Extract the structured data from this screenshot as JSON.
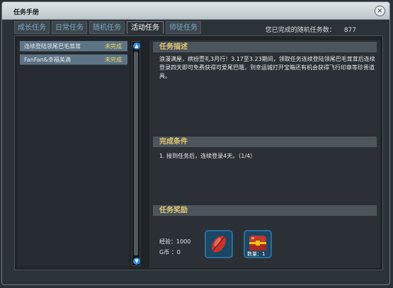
{
  "window": {
    "title": "任务手册",
    "close": "×"
  },
  "tabs": [
    {
      "label": "成长任务",
      "active": false
    },
    {
      "label": "日常任务",
      "active": false
    },
    {
      "label": "随机任务",
      "active": false
    },
    {
      "label": "活动任务",
      "active": true
    },
    {
      "label": "师徒任务",
      "active": false
    }
  ],
  "completed": {
    "label": "您已完成的随机任务数：",
    "value": "877"
  },
  "quest_list": [
    {
      "name": "连续登陆领尾巴毛茸茸",
      "status": "未完成"
    },
    {
      "name": "FanFan&幸福美满",
      "status": "未完成"
    }
  ],
  "scroll": {
    "up": "▲",
    "down": "▼"
  },
  "details": {
    "desc_title": "任务描述",
    "desc_text": "浪漫满屋，缤纷壹礼3月行！3.17至3.23期间，领取任务连续登陆领尾巴毛茸茸后连续登录四天即可免费获得可爱尾巴哦，到幸运城打开宝箱还有机会获得飞行印章等珍贵道具。",
    "cond_title": "完成条件",
    "cond_text": "1. 接到任务后，连续登录4天。（1/4）",
    "reward_title": "任务奖励",
    "exp": "经验：1000",
    "gold": "G币 ：0",
    "items": [
      {
        "icon": "red-feather-icon"
      },
      {
        "icon": "treasure-chest-icon",
        "qty": "数量：1"
      }
    ]
  },
  "colors": {
    "accent": "#e4c670",
    "status": "#e7d85a",
    "tab_inactive": "#7fa8c8"
  }
}
